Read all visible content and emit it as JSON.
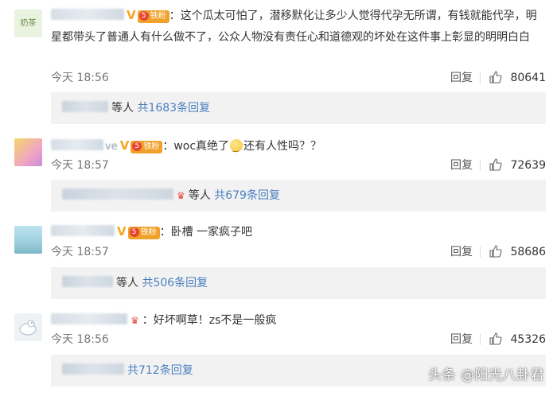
{
  "comments": [
    {
      "nick_tail": "",
      "fan_badge": "铁粉",
      "fan_level": "5",
      "text": "这个瓜太可怕了，潜移默化让多少人觉得代孕无所谓，有钱就能代孕，明星都带头了普通人有什么做不了，公众人物没有责任心和道德观的坏处在这件事上彰显的明明白白",
      "time": "今天 18:56",
      "reply_label": "回复",
      "likes": "80641",
      "sub_suffix": "等人",
      "sub_count": "共1683条回复",
      "avatar_text": "奶茶"
    },
    {
      "nick_tail": "ve",
      "fan_badge": "铁粉",
      "fan_level": "5",
      "text_before_emoji": "woc真绝了",
      "text_after_emoji": "还有人性吗？？",
      "time": "今天 18:57",
      "reply_label": "回复",
      "likes": "72639",
      "sub_suffix": "等人",
      "sub_count": "共679条回复"
    },
    {
      "nick_tail": "",
      "fan_badge": "铁粉",
      "fan_level": "5",
      "text": "卧槽 一家疯子吧",
      "time": "今天 18:57",
      "reply_label": "回复",
      "likes": "58686",
      "sub_suffix": "等人",
      "sub_count": "共506条回复"
    },
    {
      "nick_tail": "",
      "text": "好坏啊草！zs不是一般疯",
      "time": "今天 18:56",
      "reply_label": "回复",
      "likes": "45326",
      "sub_suffix": "",
      "sub_count": "共712条回复"
    }
  ],
  "watermark": "头条 @阳光八卦君",
  "colors": {
    "link": "#4a7fc0",
    "fan_badge": "#f0a12a",
    "verified": "#f5a623",
    "subbox_bg": "#f2f2f2"
  },
  "icons": {
    "like": "thumbs-up-icon",
    "verified": "v-verified-icon",
    "crown": "crown-icon"
  }
}
